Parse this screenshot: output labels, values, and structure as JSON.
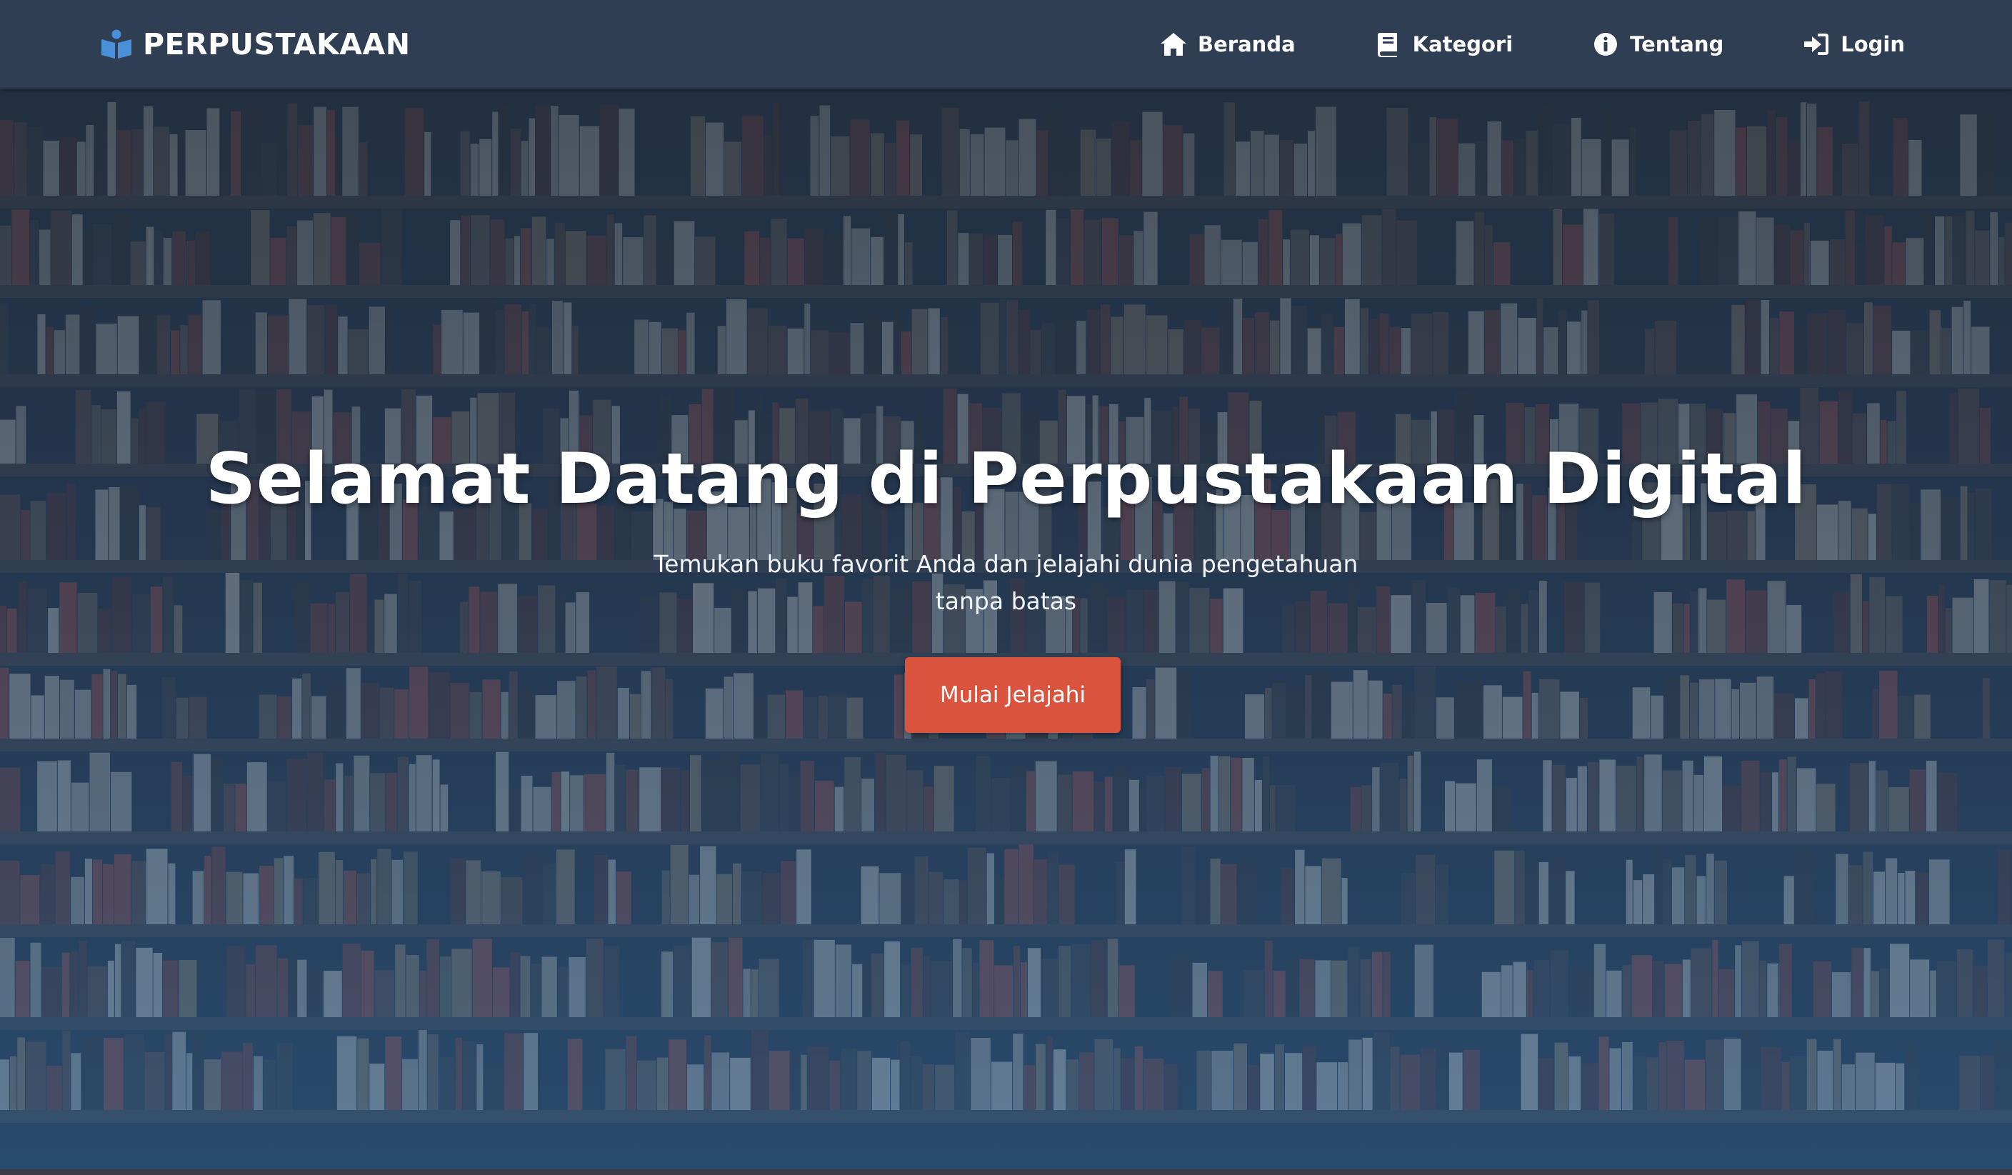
{
  "header": {
    "brand": "PERPUSTAKAAN",
    "brand_icon": "book-reader-icon",
    "nav": [
      {
        "label": "Beranda",
        "icon": "home-icon"
      },
      {
        "label": "Kategori",
        "icon": "book-icon"
      },
      {
        "label": "Tentang",
        "icon": "info-circle-icon"
      },
      {
        "label": "Login",
        "icon": "sign-in-icon"
      }
    ]
  },
  "hero": {
    "title": "Selamat Datang di Perpustakaan Digital",
    "subtitle": "Temukan buku favorit Anda dan jelajahi dunia pengetahuan tanpa batas",
    "cta_label": "Mulai Jelajahi"
  },
  "colors": {
    "navbar": "#2f3e52",
    "cta": "#d9533f",
    "brand_icon": "#4a90d9"
  }
}
